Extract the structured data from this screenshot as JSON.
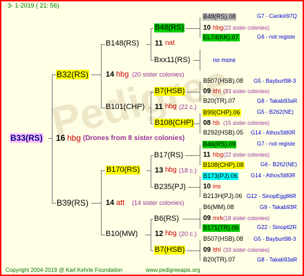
{
  "header": "3-  1-2019 ( 21: 56)",
  "watermark": "Pedigree",
  "footer": {
    "copyright": "Copyright 2004-2019 @ Karl Kehrle Foundation",
    "site": "www.pedigreeapis.org"
  },
  "colors": {
    "yellow": "#ffff00",
    "green": "#00cc00",
    "cyan": "#00ffff",
    "gray": "#c0c0c0",
    "pink": "#ffc0ff",
    "red": "#cc0000",
    "blue": "#0000cc",
    "purple": "#993399",
    "border": "#ff0000",
    "background": "#ffffe6"
  },
  "root": {
    "code": "B33(RS)",
    "year": "16",
    "label": "hbg",
    "note": "(Drones from 8 sister colonies)"
  },
  "gen1": {
    "b32": {
      "code": "B32(RS)",
      "year": "14",
      "label": "hbg",
      "note": "(20 sister colonies)"
    },
    "b39": {
      "code": "B39(RS)",
      "year": "14",
      "label": "att",
      "note": "(14 sister colonies)"
    }
  },
  "gen2": {
    "b148": {
      "code": "B148(RS)",
      "year": "11",
      "label": "nat"
    },
    "b101": {
      "code": "B101(CHP)",
      "year": "11",
      "label": "hbg",
      "note": "(22 c.)"
    },
    "b170": {
      "code": "B170(RS)",
      "year": "13",
      "label": "hbg",
      "note": "(18 c.)"
    },
    "b10": {
      "code": "B10(MW)",
      "year": "12",
      "label": "hbg",
      "note": "(20 c.)"
    }
  },
  "gen3": {
    "b48": {
      "code": "B48(RS)",
      "year": "10",
      "label": "hbg",
      "note": "(22 sister colonies)"
    },
    "bxx11": {
      "code": "Bxx11(RS)",
      "nomore": "no more"
    },
    "b7a": {
      "code": "B7(HSB)",
      "year": "09",
      "label": "lthl",
      "note": "(33 sister colonies)"
    },
    "b108": {
      "code": "B108(CHP)",
      "year": "08",
      "label": "hb",
      "note": "(15 sister colonies)"
    },
    "b17": {
      "code": "B17(RS)",
      "year": "11",
      "label": "hbg",
      "note": "(22 sister colonies)"
    },
    "b235": {
      "code": "B235(PJ)",
      "year": "10",
      "label": "ins"
    },
    "b6": {
      "code": "B6(RS)",
      "year": "09",
      "label": "mrk",
      "note": "(18 sister colonies)"
    },
    "b7b": {
      "code": "B7(HSB)",
      "year": "09",
      "label": "lthl",
      "note": "(33 sister colonies)"
    }
  },
  "gen4": [
    {
      "code": "B48(RS).08",
      "info": "G7 - Cankiri97Q"
    },
    {
      "code": "EL74(KK).07",
      "info": "G6 - not registe"
    },
    {
      "code": "B507(HSB).08",
      "info": "G5 - Bayburt98-3"
    },
    {
      "code": "B20(TR).07",
      "info": "G8 - Takab93aR"
    },
    {
      "code": "B99(CHP).06",
      "info": "G5 - B262(NE)"
    },
    {
      "code": "B292(HSB).05",
      "info": "G14 - AthosSt80R"
    },
    {
      "code": "B46(RS).09",
      "info": "G7 - not registe"
    },
    {
      "code": "B108(CHP).08",
      "info": "G6 - B262(NE)"
    },
    {
      "code": "B173(PJ).06",
      "info": "G14 - AthosSt80R"
    },
    {
      "code": "B213H(PJ).06",
      "info": "G12 - SinopEgg86R"
    },
    {
      "code": "B6(MM).08",
      "info": "G9 - Takab93R"
    },
    {
      "code": "B171(TR).06",
      "info": "G22 - Sinop62R"
    },
    {
      "code": "B507(HSB).08",
      "info": "G5 - Bayburt98-3"
    },
    {
      "code": "B20(TR).07",
      "info": "G8 - Takab93aR"
    }
  ]
}
